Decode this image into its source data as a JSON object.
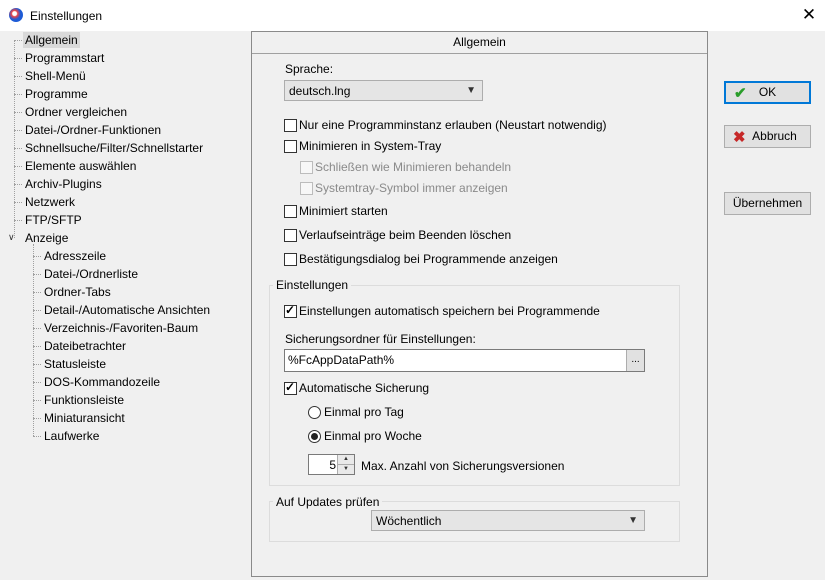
{
  "window": {
    "title": "Einstellungen",
    "close_glyph": "✕"
  },
  "tree": {
    "top_items": [
      "Allgemein",
      "Programmstart",
      "Shell-Menü",
      "Programme",
      "Ordner vergleichen",
      "Datei-/Ordner-Funktionen",
      "Schnellsuche/Filter/Schnellstarter",
      "Elemente auswählen",
      "Archiv-Plugins",
      "Netzwerk",
      "FTP/SFTP",
      "Anzeige"
    ],
    "sub_items": [
      "Adresszeile",
      "Datei-/Ordnerliste",
      "Ordner-Tabs",
      "Detail-/Automatische Ansichten",
      "Verzeichnis-/Favoriten-Baum",
      "Dateibetrachter",
      "Statusleiste",
      "DOS-Kommandozeile",
      "Funktionsleiste",
      "Miniaturansicht",
      "Laufwerke"
    ],
    "expander_glyph": "∨"
  },
  "panel": {
    "header": "Allgemein",
    "language_label": "Sprache:",
    "language_value": "deutsch.lng",
    "opt_single_instance": "Nur eine Programminstanz erlauben (Neustart notwendig)",
    "opt_minimize_tray": "Minimieren in System-Tray",
    "opt_close_as_minimize": "Schließen wie Minimieren behandeln",
    "opt_tray_icon_always": "Systemtray-Symbol immer anzeigen",
    "opt_start_minimized": "Minimiert starten",
    "opt_clear_history": "Verlaufseinträge beim Beenden löschen",
    "opt_confirm_exit": "Bestätigungsdialog bei Programmende anzeigen",
    "settings_group": {
      "title": "Einstellungen",
      "auto_save": "Einstellungen automatisch speichern bei Programmende",
      "backup_folder_label": "Sicherungsordner für Einstellungen:",
      "backup_folder_value": "%FcAppDataPath%",
      "browse_glyph": "...",
      "auto_backup": "Automatische Sicherung",
      "once_per_day": "Einmal pro Tag",
      "once_per_week": "Einmal pro Woche",
      "max_versions_value": "5",
      "max_versions_label": "Max. Anzahl von Sicherungsversionen"
    },
    "updates_group": {
      "title": "Auf Updates prüfen",
      "value": "Wöchentlich"
    }
  },
  "buttons": {
    "ok": "OK",
    "cancel": "Abbruch",
    "apply": "Übernehmen",
    "ok_icon": "✔",
    "cancel_icon": "✖"
  },
  "colors": {
    "focus": "#0078d7",
    "ok_icon": "#2a9d2a",
    "cancel_icon": "#c62828"
  }
}
